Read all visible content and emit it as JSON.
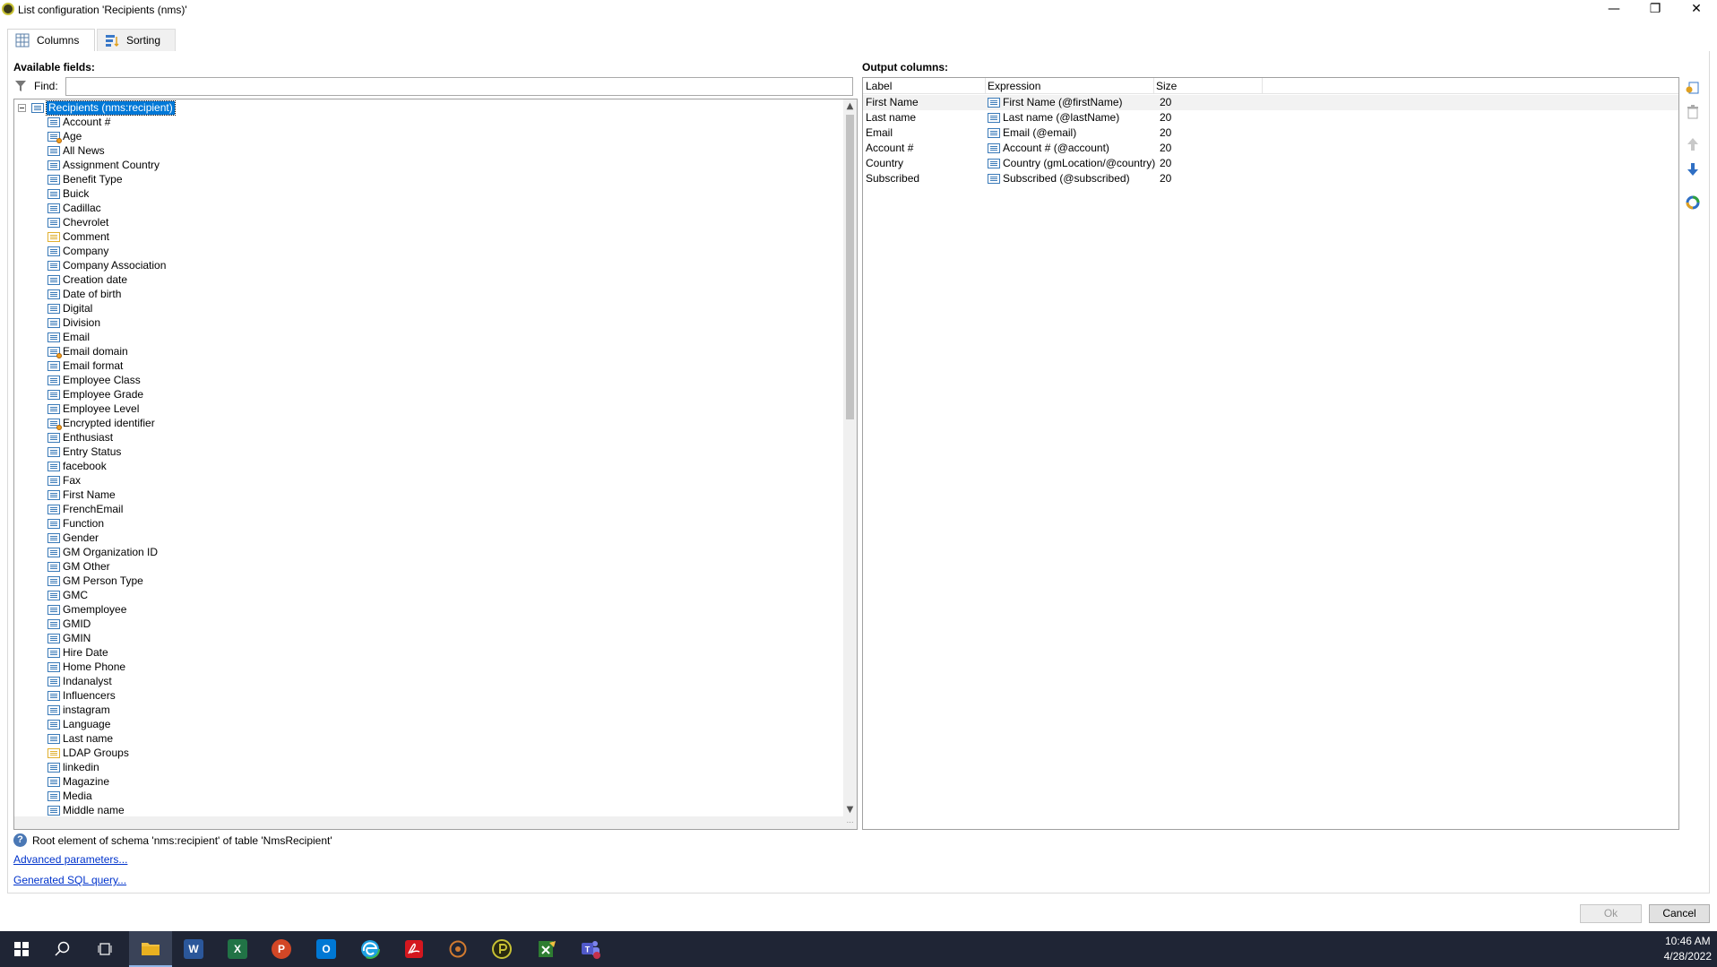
{
  "window": {
    "title": "List configuration 'Recipients (nms)'",
    "minimize": "—",
    "restore": "❐",
    "close": "✕"
  },
  "tabs": [
    {
      "label": "Columns",
      "icon": "table-grid-icon"
    },
    {
      "label": "Sorting",
      "icon": "sort-icon"
    }
  ],
  "available": {
    "heading": "Available fields:",
    "find_label": "Find:",
    "find_value": "",
    "root": "Recipients (nms:recipient)",
    "fields": [
      {
        "label": "Account #",
        "icon": "field"
      },
      {
        "label": "Age",
        "icon": "calc"
      },
      {
        "label": "All News",
        "icon": "field"
      },
      {
        "label": "Assignment Country",
        "icon": "field"
      },
      {
        "label": "Benefit Type",
        "icon": "field"
      },
      {
        "label": "Buick",
        "icon": "field"
      },
      {
        "label": "Cadillac",
        "icon": "field"
      },
      {
        "label": "Chevrolet",
        "icon": "field"
      },
      {
        "label": "Comment",
        "icon": "memo"
      },
      {
        "label": "Company",
        "icon": "field"
      },
      {
        "label": "Company Association",
        "icon": "field"
      },
      {
        "label": "Creation date",
        "icon": "field"
      },
      {
        "label": "Date of birth",
        "icon": "field"
      },
      {
        "label": "Digital",
        "icon": "field"
      },
      {
        "label": "Division",
        "icon": "field"
      },
      {
        "label": "Email",
        "icon": "field"
      },
      {
        "label": "Email domain",
        "icon": "calc"
      },
      {
        "label": "Email format",
        "icon": "field"
      },
      {
        "label": "Employee Class",
        "icon": "field"
      },
      {
        "label": "Employee Grade",
        "icon": "field"
      },
      {
        "label": "Employee Level",
        "icon": "field"
      },
      {
        "label": "Encrypted identifier",
        "icon": "calc"
      },
      {
        "label": "Enthusiast",
        "icon": "field"
      },
      {
        "label": "Entry Status",
        "icon": "field"
      },
      {
        "label": "facebook",
        "icon": "field"
      },
      {
        "label": "Fax",
        "icon": "field"
      },
      {
        "label": "First Name",
        "icon": "field"
      },
      {
        "label": "FrenchEmail",
        "icon": "field"
      },
      {
        "label": "Function",
        "icon": "field"
      },
      {
        "label": "Gender",
        "icon": "field"
      },
      {
        "label": "GM Organization ID",
        "icon": "field"
      },
      {
        "label": "GM Other",
        "icon": "field"
      },
      {
        "label": "GM Person Type",
        "icon": "field"
      },
      {
        "label": "GMC",
        "icon": "field"
      },
      {
        "label": "Gmemployee",
        "icon": "field"
      },
      {
        "label": "GMID",
        "icon": "field"
      },
      {
        "label": "GMIN",
        "icon": "field"
      },
      {
        "label": "Hire Date",
        "icon": "field"
      },
      {
        "label": "Home Phone",
        "icon": "field"
      },
      {
        "label": "Indanalyst",
        "icon": "field"
      },
      {
        "label": "Influencers",
        "icon": "field"
      },
      {
        "label": "instagram",
        "icon": "field"
      },
      {
        "label": "Language",
        "icon": "field"
      },
      {
        "label": "Last name",
        "icon": "field"
      },
      {
        "label": "LDAP Groups",
        "icon": "memo"
      },
      {
        "label": "linkedin",
        "icon": "field"
      },
      {
        "label": "Magazine",
        "icon": "field"
      },
      {
        "label": "Media",
        "icon": "field"
      },
      {
        "label": "Middle name",
        "icon": "field"
      }
    ]
  },
  "output": {
    "heading": "Output columns:",
    "columns": [
      "Label",
      "Expression",
      "Size"
    ],
    "rows": [
      {
        "label": "First Name",
        "expression": "First Name (@firstName)",
        "size": "20"
      },
      {
        "label": "Last name",
        "expression": "Last name (@lastName)",
        "size": "20"
      },
      {
        "label": "Email",
        "expression": "Email (@email)",
        "size": "20"
      },
      {
        "label": "Account #",
        "expression": "Account # (@account)",
        "size": "20"
      },
      {
        "label": "Country",
        "expression": "Country (gmLocation/@country)",
        "size": "20"
      },
      {
        "label": "Subscribed",
        "expression": "Subscribed (@subscribed)",
        "size": "20"
      }
    ]
  },
  "status": {
    "help_text": "Root element of schema 'nms:recipient' of table 'NmsRecipient'",
    "advanced_link": "Advanced parameters...",
    "sql_link": "Generated SQL query..."
  },
  "buttons": {
    "ok": "Ok",
    "cancel": "Cancel"
  },
  "taskbar": {
    "apps": [
      "start",
      "search",
      "task-view",
      "file-explorer",
      "word",
      "excel",
      "powerpoint",
      "outlook",
      "edge",
      "acrobat",
      "app-circle",
      "app-p",
      "app-sheet",
      "teams"
    ],
    "word": "W",
    "excel": "X",
    "powerpoint": "P",
    "outlook": "O",
    "time": "10:46 AM",
    "date": "4/28/2022"
  }
}
